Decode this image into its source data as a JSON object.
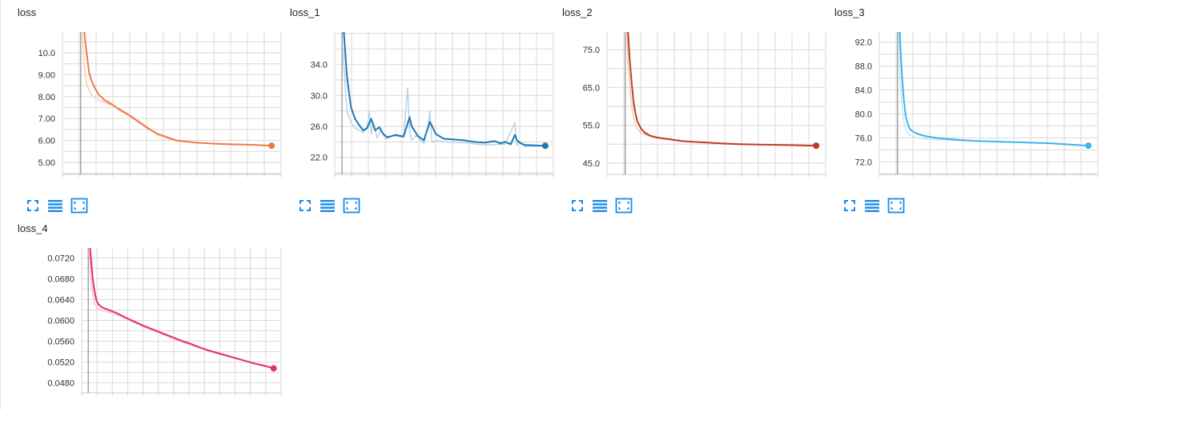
{
  "chart_data": [
    {
      "type": "line",
      "title": "loss",
      "color": "#f07a48",
      "smooth_color": "#f9cdbd",
      "yticks": [
        "5.00",
        "6.00",
        "7.00",
        "8.00",
        "9.00",
        "10.0"
      ],
      "ylim": [
        4.45,
        10.95
      ],
      "xlim": [
        -0.1,
        1.05
      ],
      "series": [
        {
          "x": [
            0.0,
            0.01,
            0.02,
            0.03,
            0.04,
            0.05,
            0.07,
            0.09,
            0.12,
            0.16,
            0.2,
            0.25,
            0.3,
            0.35,
            0.4,
            0.45,
            0.5,
            0.55,
            0.6,
            0.7,
            0.8,
            0.9,
            1.0
          ],
          "y": [
            12.5,
            11.4,
            10.5,
            9.8,
            9.1,
            8.8,
            8.4,
            8.1,
            7.85,
            7.65,
            7.4,
            7.15,
            6.85,
            6.55,
            6.3,
            6.15,
            6.0,
            5.95,
            5.9,
            5.85,
            5.82,
            5.8,
            5.76
          ]
        },
        {
          "x": [
            0.0,
            0.01,
            0.02,
            0.03,
            0.05,
            0.07,
            0.1,
            0.13,
            0.16,
            0.2,
            0.25,
            0.3,
            0.35,
            0.4,
            0.45,
            0.5,
            0.6,
            0.7,
            0.8,
            0.9,
            1.0
          ],
          "y": [
            11.5,
            10.0,
            9.0,
            8.5,
            8.1,
            7.95,
            7.8,
            7.7,
            7.6,
            7.45,
            7.2,
            6.9,
            6.6,
            6.25,
            6.1,
            5.98,
            5.9,
            5.85,
            5.82,
            5.8,
            5.77
          ]
        }
      ]
    },
    {
      "type": "line",
      "title": "loss_1",
      "color": "#1f77b4",
      "smooth_color": "#b5d5ea",
      "yticks": [
        "22.0",
        "26.0",
        "30.0",
        "34.0"
      ],
      "ylim": [
        19.8,
        38.2
      ],
      "xlim": [
        -0.04,
        1.04
      ],
      "series": [
        {
          "x": [
            0.0,
            0.02,
            0.04,
            0.06,
            0.08,
            0.1,
            0.12,
            0.14,
            0.15,
            0.16,
            0.18,
            0.2,
            0.22,
            0.26,
            0.3,
            0.33,
            0.34,
            0.37,
            0.4,
            0.42,
            0.43,
            0.46,
            0.5,
            0.6,
            0.65,
            0.7,
            0.75,
            0.78,
            0.8,
            0.83,
            0.85,
            0.86,
            0.88,
            0.9,
            1.0
          ],
          "y": [
            40.0,
            32.5,
            28.5,
            27.0,
            26.2,
            25.5,
            25.8,
            27.0,
            26.2,
            25.5,
            25.9,
            25.0,
            24.6,
            24.9,
            24.7,
            27.2,
            26.0,
            24.8,
            24.2,
            25.8,
            26.6,
            25.0,
            24.4,
            24.2,
            24.0,
            23.9,
            24.1,
            23.8,
            24.0,
            23.7,
            24.9,
            24.2,
            23.8,
            23.6,
            23.5
          ]
        },
        {
          "x": [
            0.0,
            0.02,
            0.04,
            0.06,
            0.08,
            0.1,
            0.12,
            0.13,
            0.14,
            0.15,
            0.17,
            0.19,
            0.21,
            0.25,
            0.3,
            0.32,
            0.33,
            0.34,
            0.36,
            0.4,
            0.42,
            0.43,
            0.44,
            0.47,
            0.5,
            0.6,
            0.7,
            0.8,
            0.85,
            0.86,
            0.87,
            0.9,
            1.0
          ],
          "y": [
            36.0,
            28.0,
            26.5,
            25.8,
            25.5,
            25.2,
            25.7,
            28.0,
            25.0,
            26.5,
            24.5,
            25.6,
            24.4,
            24.8,
            24.6,
            31.0,
            25.5,
            24.2,
            24.8,
            23.8,
            26.0,
            28.0,
            24.0,
            24.2,
            24.0,
            23.9,
            23.6,
            23.7,
            26.5,
            23.5,
            24.0,
            23.4,
            23.5
          ]
        }
      ]
    },
    {
      "type": "line",
      "title": "loss_2",
      "color": "#c23b21",
      "smooth_color": "#f4c7bd",
      "yticks": [
        "45.0",
        "55.0",
        "65.0",
        "75.0"
      ],
      "ylim": [
        42.0,
        79.7
      ],
      "xlim": [
        -0.1,
        1.05
      ],
      "series": [
        {
          "x": [
            0.0,
            0.01,
            0.02,
            0.03,
            0.04,
            0.05,
            0.06,
            0.08,
            0.1,
            0.13,
            0.16,
            0.2,
            0.3,
            0.4,
            0.5,
            0.6,
            0.7,
            0.8,
            0.9,
            1.0
          ],
          "y": [
            95.0,
            80.0,
            72.0,
            66.0,
            61.0,
            58.0,
            56.0,
            54.0,
            53.0,
            52.2,
            51.8,
            51.5,
            50.8,
            50.5,
            50.2,
            50.0,
            49.9,
            49.8,
            49.7,
            49.6
          ]
        },
        {
          "x": [
            0.0,
            0.01,
            0.02,
            0.03,
            0.04,
            0.05,
            0.06,
            0.08,
            0.1,
            0.13,
            0.16,
            0.2,
            0.3,
            0.4,
            0.5,
            0.6,
            0.7,
            0.8,
            0.9,
            1.0
          ],
          "y": [
            85.0,
            72.0,
            65.0,
            60.0,
            57.0,
            55.0,
            54.0,
            53.0,
            52.5,
            52.0,
            51.7,
            51.4,
            50.8,
            50.5,
            50.2,
            50.0,
            49.9,
            49.8,
            49.7,
            49.6
          ]
        }
      ]
    },
    {
      "type": "line",
      "title": "loss_3",
      "color": "#3bb4ea",
      "smooth_color": "#c6e7f6",
      "yticks": [
        "72.0",
        "76.0",
        "80.0",
        "84.0",
        "88.0",
        "92.0"
      ],
      "ylim": [
        69.9,
        93.7
      ],
      "xlim": [
        -0.1,
        1.05
      ],
      "series": [
        {
          "x": [
            0.0,
            0.01,
            0.02,
            0.03,
            0.04,
            0.05,
            0.06,
            0.08,
            0.1,
            0.13,
            0.16,
            0.2,
            0.3,
            0.4,
            0.5,
            0.6,
            0.7,
            0.8,
            0.9,
            1.0
          ],
          "y": [
            100.0,
            92.0,
            86.0,
            82.0,
            79.5,
            78.3,
            77.5,
            77.0,
            76.7,
            76.4,
            76.2,
            76.0,
            75.7,
            75.5,
            75.4,
            75.3,
            75.2,
            75.1,
            74.9,
            74.7
          ]
        },
        {
          "x": [
            0.0,
            0.01,
            0.02,
            0.03,
            0.04,
            0.05,
            0.06,
            0.08,
            0.1,
            0.13,
            0.16,
            0.2,
            0.3,
            0.4,
            0.5,
            0.6,
            0.7,
            0.8,
            0.9,
            1.0
          ],
          "y": [
            95.0,
            86.0,
            81.0,
            78.5,
            77.3,
            76.8,
            76.5,
            76.2,
            76.0,
            75.9,
            75.8,
            75.7,
            75.6,
            75.5,
            75.4,
            75.3,
            75.2,
            75.1,
            74.9,
            74.7
          ]
        }
      ]
    },
    {
      "type": "line",
      "title": "loss_4",
      "color": "#e52f6e",
      "smooth_color": "#f7c3d4",
      "yticks": [
        "0.0480",
        "0.0520",
        "0.0560",
        "0.0600",
        "0.0640",
        "0.0680",
        "0.0720"
      ],
      "ylim": [
        0.0461,
        0.0739
      ],
      "xlim": [
        -0.04,
        1.04
      ],
      "series": [
        {
          "x": [
            0.0,
            0.01,
            0.02,
            0.03,
            0.04,
            0.05,
            0.07,
            0.1,
            0.15,
            0.2,
            0.25,
            0.3,
            0.35,
            0.4,
            0.45,
            0.5,
            0.55,
            0.6,
            0.65,
            0.7,
            0.75,
            0.8,
            0.85,
            0.9,
            0.95,
            1.0
          ],
          "y": [
            0.076,
            0.072,
            0.068,
            0.0655,
            0.0638,
            0.0631,
            0.0625,
            0.0621,
            0.0614,
            0.0605,
            0.0597,
            0.0589,
            0.0582,
            0.0575,
            0.0568,
            0.0561,
            0.0555,
            0.0548,
            0.0542,
            0.0537,
            0.0532,
            0.0527,
            0.0522,
            0.0517,
            0.0513,
            0.0508
          ]
        },
        {
          "x": [
            0.0,
            0.01,
            0.02,
            0.03,
            0.04,
            0.05,
            0.07,
            0.1,
            0.15,
            0.2,
            0.25,
            0.3,
            0.35,
            0.4,
            0.45,
            0.5,
            0.55,
            0.6,
            0.65,
            0.7,
            0.75,
            0.8,
            0.85,
            0.9,
            0.95,
            1.0
          ],
          "y": [
            0.073,
            0.068,
            0.065,
            0.0632,
            0.0626,
            0.0622,
            0.0619,
            0.0617,
            0.0611,
            0.0603,
            0.0595,
            0.0587,
            0.058,
            0.0573,
            0.0566,
            0.0559,
            0.0553,
            0.0547,
            0.0541,
            0.0536,
            0.0531,
            0.0526,
            0.0521,
            0.0516,
            0.0512,
            0.0507
          ]
        }
      ]
    }
  ],
  "toolbar": {
    "icon_color": "#1e88e5",
    "icons": [
      "fullscreen-icon",
      "list-icon",
      "fit-domain-icon"
    ]
  }
}
